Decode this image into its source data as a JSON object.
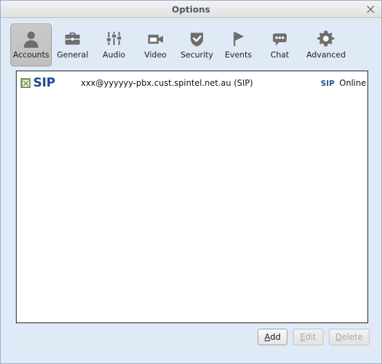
{
  "window": {
    "title": "Options",
    "close_label": "×",
    "close_icon": "close-icon",
    "background_color": "#dfeaf6",
    "titlebar_color": "#eaeaea"
  },
  "toolbar": {
    "items": [
      {
        "label": "Accounts",
        "icon": "user-silhouette-icon",
        "selected": true
      },
      {
        "label": "General",
        "icon": "briefcase-icon",
        "selected": false
      },
      {
        "label": "Audio",
        "icon": "audio-sliders-icon",
        "selected": false
      },
      {
        "label": "Video",
        "icon": "video-camera-icon",
        "selected": false
      },
      {
        "label": "Security",
        "icon": "shield-check-icon",
        "selected": false
      },
      {
        "label": "Events",
        "icon": "flag-icon",
        "selected": false
      },
      {
        "label": "Chat",
        "icon": "speech-bubble-icon",
        "selected": false
      },
      {
        "label": "Advanced",
        "icon": "gear-icon",
        "selected": false
      }
    ]
  },
  "accounts": {
    "rows": [
      {
        "enabled": true,
        "enabled_icon": "checkbox-checked-green-icon",
        "protocol": "SIP",
        "address": "xxx@yyyyyy-pbx.cust.spintel.net.au (SIP)",
        "status_protocol": "SIP",
        "status": "Online",
        "protocol_color": "#1b4a8f",
        "enabled_color": "#8fb96a"
      }
    ]
  },
  "buttons": {
    "add": {
      "label": "Add",
      "mnemonic": "A",
      "rest": "dd",
      "enabled": true
    },
    "edit": {
      "label": "Edit",
      "mnemonic": "E",
      "rest": "dit",
      "enabled": false
    },
    "delete": {
      "label": "Delete",
      "mnemonic": "D",
      "rest": "elete",
      "enabled": false
    }
  }
}
